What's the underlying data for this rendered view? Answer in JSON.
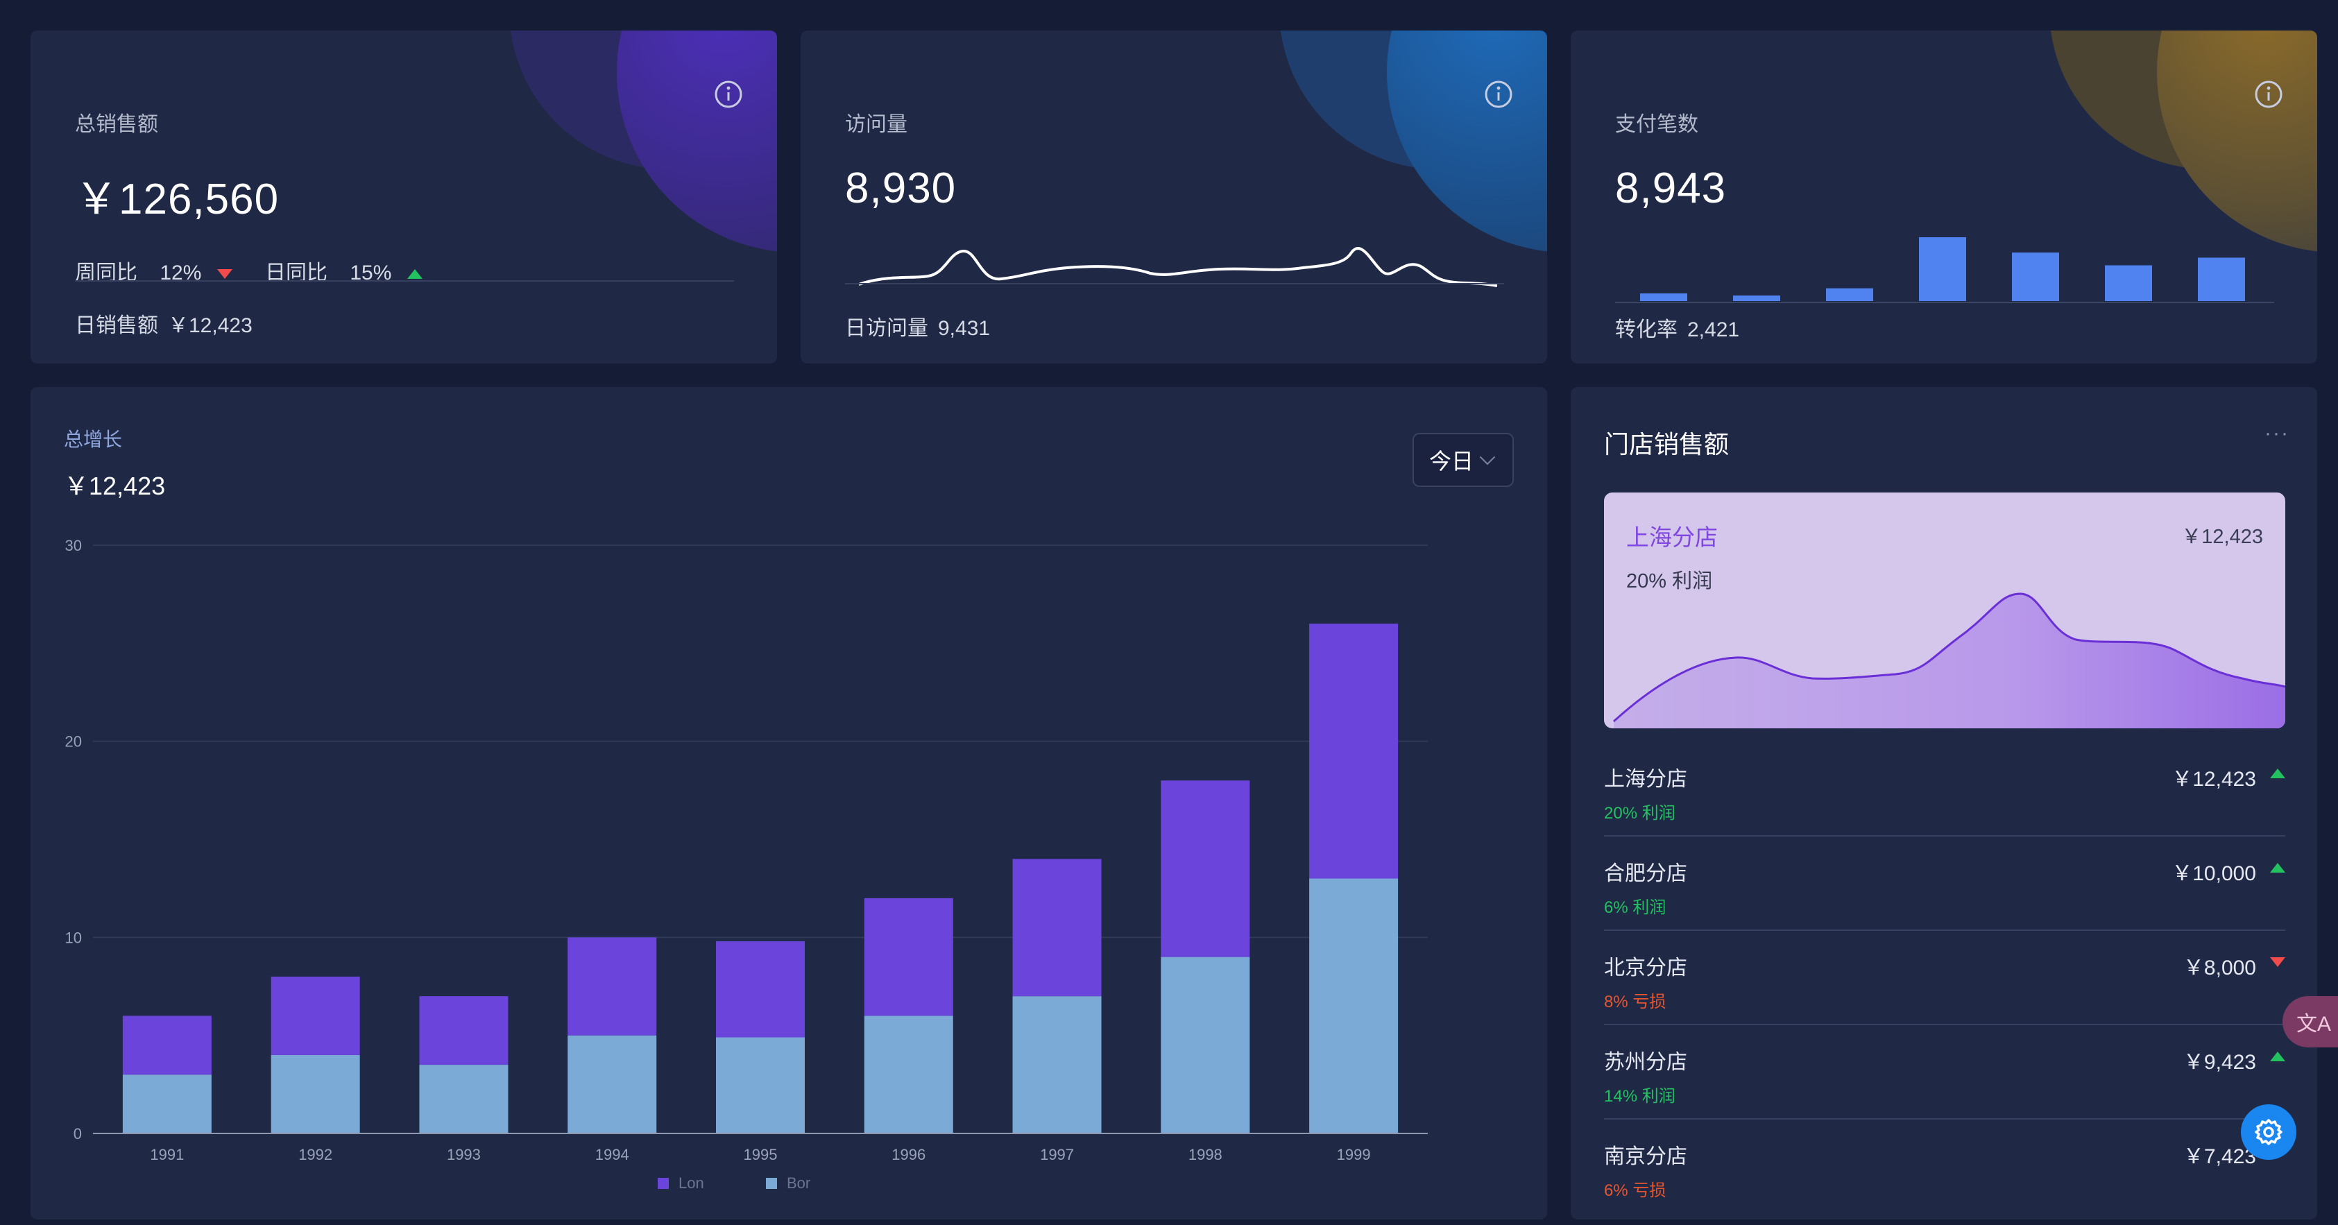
{
  "cards": {
    "sales": {
      "label": "总销售额",
      "value": "￥126,560",
      "weekly_label": "周同比",
      "weekly_pct": "12%",
      "daily_label": "日同比",
      "daily_pct": "15%",
      "footer_label": "日销售额",
      "footer_value": "￥12,423"
    },
    "visits": {
      "label": "访问量",
      "value": "8,930",
      "footer_label": "日访问量",
      "footer_value": "9,431"
    },
    "payments": {
      "label": "支付笔数",
      "value": "8,943",
      "footer_label": "转化率",
      "footer_value": "2,421",
      "mini_bars": [
        0.12,
        0.08,
        0.2,
        1.0,
        0.76,
        0.56,
        0.68
      ]
    }
  },
  "growth": {
    "label": "总增长",
    "value": "￥12,423",
    "period": "今日"
  },
  "chart_data": {
    "type": "bar",
    "stacked": true,
    "categories": [
      "1991",
      "1992",
      "1993",
      "1994",
      "1995",
      "1996",
      "1997",
      "1998",
      "1999"
    ],
    "series": [
      {
        "name": "Bor",
        "color": "#7aaad5",
        "values": [
          3,
          4,
          3.5,
          5,
          4.9,
          6,
          7,
          9,
          13
        ]
      },
      {
        "name": "Lon",
        "color": "#6b44db",
        "values": [
          3,
          4,
          3.5,
          5,
          4.9,
          6,
          7,
          9,
          13
        ]
      }
    ],
    "legend": [
      "Lon",
      "Bor"
    ],
    "ylim": [
      0,
      30
    ],
    "yticks": [
      "0",
      "10",
      "20",
      "30"
    ],
    "grid": true,
    "legend_position": "bottom"
  },
  "stores": {
    "title": "门店销售额",
    "more": "···",
    "hero": {
      "name": "上海分店",
      "amount": "￥12,423",
      "profit": "20% 利润"
    },
    "items": [
      {
        "name": "上海分店",
        "profit": "20% 利润",
        "amount": "￥12,423",
        "trend": "up"
      },
      {
        "name": "合肥分店",
        "profit": "6% 利润",
        "amount": "￥10,000",
        "trend": "up"
      },
      {
        "name": "北京分店",
        "profit": "8% 亏损",
        "amount": "￥8,000",
        "trend": "down"
      },
      {
        "name": "苏州分店",
        "profit": "14% 利润",
        "amount": "￥9,423",
        "trend": "up"
      },
      {
        "name": "南京分店",
        "profit": "6% 亏损",
        "amount": "￥7,423",
        "trend": "down"
      }
    ]
  },
  "widgets": {
    "translate_label": "文A"
  },
  "colors": {
    "up": "#23c160",
    "down": "#f24b4b",
    "loss_text": "#e8562f",
    "profit_text": "#23c160"
  }
}
